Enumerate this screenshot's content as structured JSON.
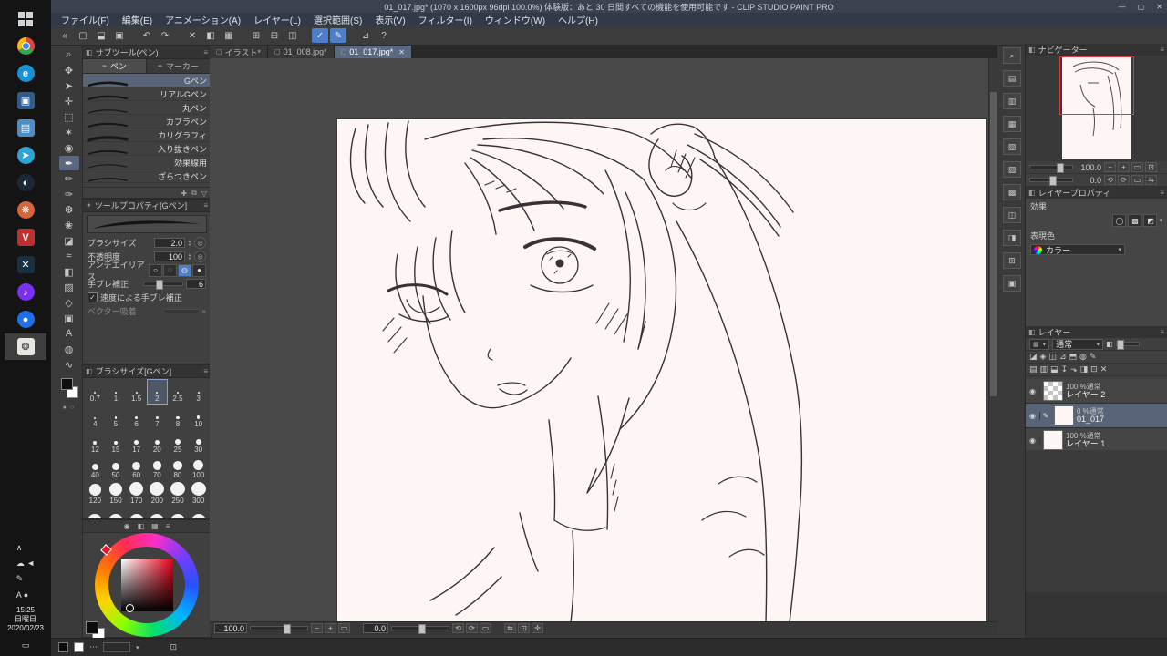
{
  "colors": {
    "accent": "#4f7dc8",
    "selection": "#5a6478",
    "paper": "#fdf6f4",
    "nav_frame": "#e03a3a",
    "line_art": "#3a3136",
    "taskbar_selected": "#3f3f3f"
  },
  "ui": {
    "header_tab_glyph": "◧",
    "panel_menu_glyph": "≡",
    "pen_tab_glyph": "✒",
    "close_glyph": "✕",
    "doc_glyph": "▢"
  },
  "taskbar": {
    "icons": [
      {
        "name": "start",
        "shape": "win",
        "glyph": ""
      },
      {
        "name": "chrome",
        "shape": "chrome",
        "glyph": ""
      },
      {
        "name": "edge",
        "shape": "circle",
        "glyph": "e",
        "bg": "#1493d6"
      },
      {
        "name": "pinned-app-1",
        "shape": "square",
        "glyph": "▣",
        "bg": "#2d5e8f"
      },
      {
        "name": "pinned-app-2",
        "shape": "square",
        "glyph": "▤",
        "bg": "#4d8fc4"
      },
      {
        "name": "telegram",
        "shape": "circle",
        "glyph": "➤",
        "bg": "#2ea3d6"
      },
      {
        "name": "steam",
        "shape": "circle",
        "glyph": "◐",
        "bg": "#1b2838"
      },
      {
        "name": "pinned-app-3",
        "shape": "circle",
        "glyph": "❋",
        "bg": "#d9643a"
      },
      {
        "name": "voice-app",
        "shape": "square",
        "glyph": "V",
        "bg": "#c02e2e"
      },
      {
        "name": "pinned-app-4",
        "shape": "square",
        "glyph": "✕",
        "bg": "#173042"
      },
      {
        "name": "music-app",
        "shape": "circle",
        "glyph": "♪",
        "bg": "#7b2ff7"
      },
      {
        "name": "pinned-app-5",
        "shape": "circle",
        "glyph": "●",
        "bg": "#1f6feb"
      },
      {
        "name": "clip-studio-paint",
        "shape": "square",
        "glyph": "❂",
        "bg": "#e9e5df",
        "fg": "#3a3a3a",
        "selected": true
      }
    ],
    "tray": [
      {
        "name": "tray-chevron-icon",
        "glyph": "∧"
      },
      {
        "name": "tray-cloud-volume-icons",
        "glyph": "☁ ◄"
      },
      {
        "name": "tray-pen-icon",
        "glyph": "✎"
      },
      {
        "name": "tray-ime-icons",
        "glyph": "A ●"
      }
    ],
    "clock": {
      "time": "15:25",
      "weekday": "日曜日",
      "date": "2020/02/23"
    },
    "show_desktop_glyph": "▭"
  },
  "window": {
    "title": "01_017.jpg* (1070 x 1600px 96dpi 100.0%) 体験版：あと 30 日間すべての機能を使用可能です - CLIP STUDIO PAINT PRO",
    "controls": {
      "minimize": "—",
      "maximize": "▢",
      "close": "✕"
    },
    "menus": [
      {
        "name": "file",
        "label": "ファイル(F)"
      },
      {
        "name": "edit",
        "label": "編集(E)"
      },
      {
        "name": "animation",
        "label": "アニメーション(A)"
      },
      {
        "name": "layer",
        "label": "レイヤー(L)"
      },
      {
        "name": "selection",
        "label": "選択範囲(S)"
      },
      {
        "name": "view",
        "label": "表示(V)"
      },
      {
        "name": "filter",
        "label": "フィルター(I)"
      },
      {
        "name": "window",
        "label": "ウィンドウ(W)"
      },
      {
        "name": "help",
        "label": "ヘルプ(H)"
      }
    ],
    "toolbar": [
      {
        "name": "collapse-left",
        "glyph": "«"
      },
      {
        "name": "new-canvas",
        "glyph": "▢"
      },
      {
        "name": "open-file",
        "glyph": "⬓"
      },
      {
        "name": "save-file",
        "glyph": "▣"
      },
      {
        "sep": true
      },
      {
        "name": "undo",
        "glyph": "↶"
      },
      {
        "name": "redo",
        "glyph": "↷"
      },
      {
        "sep": true
      },
      {
        "name": "delete",
        "glyph": "✕"
      },
      {
        "name": "fill",
        "glyph": "◧"
      },
      {
        "name": "grid",
        "glyph": "▦"
      },
      {
        "sep": true
      },
      {
        "name": "snap-to-ruler",
        "glyph": "⊞"
      },
      {
        "name": "snap-to-special-ruler",
        "glyph": "⊟"
      },
      {
        "name": "snap-to-grid",
        "glyph": "◫"
      },
      {
        "sep": true
      },
      {
        "name": "select-vector",
        "glyph": "✓",
        "active": true
      },
      {
        "name": "edit-vector",
        "glyph": "✎",
        "active": true
      },
      {
        "sep": true
      },
      {
        "name": "ruler",
        "glyph": "⊿"
      },
      {
        "name": "help",
        "glyph": "?"
      }
    ],
    "toolstrip": {
      "selected": 7,
      "tools": [
        {
          "name": "zoom-tool",
          "glyph": "⌕"
        },
        {
          "name": "move-tool",
          "glyph": "✥"
        },
        {
          "name": "operation-tool",
          "glyph": "➤"
        },
        {
          "name": "layer-move-tool",
          "glyph": "✛"
        },
        {
          "name": "marquee-tool",
          "glyph": "⬚"
        },
        {
          "name": "auto-select-tool",
          "glyph": "✶"
        },
        {
          "name": "eyedropper-tool",
          "glyph": "◉"
        },
        {
          "name": "pen-tool",
          "glyph": "✒"
        },
        {
          "name": "pencil-tool",
          "glyph": "✏"
        },
        {
          "name": "brush-tool",
          "glyph": "✑"
        },
        {
          "name": "airbrush-tool",
          "glyph": "❆"
        },
        {
          "name": "decoration-tool",
          "glyph": "❀"
        },
        {
          "name": "eraser-tool",
          "glyph": "◪"
        },
        {
          "name": "blend-tool",
          "glyph": "≈"
        },
        {
          "name": "fill-tool",
          "glyph": "◧"
        },
        {
          "name": "gradient-tool",
          "glyph": "▨"
        },
        {
          "name": "figure-tool",
          "glyph": "◇"
        },
        {
          "name": "frame-border-tool",
          "glyph": "▣"
        },
        {
          "name": "text-tool",
          "glyph": "A"
        },
        {
          "name": "balloon-tool",
          "glyph": "◍"
        },
        {
          "name": "correct-line-tool",
          "glyph": "∿"
        }
      ]
    }
  },
  "subtool_panel": {
    "title": "サブツール(ペン)",
    "tabs": [
      {
        "label": "ペン",
        "active": true
      },
      {
        "label": "マーカー",
        "active": false
      }
    ],
    "items": [
      "Gペン",
      "リアルGペン",
      "丸ペン",
      "カブラペン",
      "カリグラフィ",
      "入り抜きペン",
      "効果線用",
      "ざらつきペン"
    ],
    "selected": "Gペン",
    "stroke_widths": [
      2.6,
      2.2,
      1.2,
      2.0,
      3.2,
      1.8,
      1.1,
      1.6
    ],
    "footer_icons": [
      {
        "name": "add-subtool-icon",
        "glyph": "✚"
      },
      {
        "name": "duplicate-subtool-icon",
        "glyph": "⧉"
      },
      {
        "name": "delete-subtool-icon",
        "glyph": "▽"
      }
    ]
  },
  "tool_property": {
    "title": "ツールプロパティ[Gペン]",
    "brush_size_label": "ブラシサイズ",
    "brush_size_value": "2.0",
    "opacity_label": "不透明度",
    "opacity_value": "100",
    "antialias_label": "アンチエイリアス",
    "antialias_selected": 2,
    "antialias_glyphs": [
      "○",
      "◌",
      "◍",
      "●"
    ],
    "stabilize_label": "手ブレ補正",
    "stabilize_value": "6",
    "speed_stabilize_label": "速度による手ブレ補正",
    "vector_snap_label": "ベクター吸着"
  },
  "brush_size_panel": {
    "title": "ブラシサイズ[Gペン]",
    "sizes": [
      "0.7",
      "1",
      "1.5",
      "2",
      "2.5",
      "3",
      "4",
      "5",
      "6",
      "7",
      "8",
      "10",
      "12",
      "15",
      "17",
      "20",
      "25",
      "30",
      "40",
      "50",
      "60",
      "70",
      "80",
      "100",
      "120",
      "150",
      "170",
      "200",
      "250",
      "300"
    ],
    "selected": "2",
    "overflow_dots": 6
  },
  "color_panel": {
    "header_icons": [
      {
        "name": "color-wheel-tab-icon",
        "glyph": "◉"
      },
      {
        "name": "color-slider-tab-icon",
        "glyph": "◧"
      },
      {
        "name": "color-set-tab-icon",
        "glyph": "▦"
      },
      {
        "name": "color-history-tab-icon",
        "glyph": "≡"
      }
    ]
  },
  "canvas": {
    "tabs": [
      {
        "label": "イラスト*",
        "active": false
      },
      {
        "label": "01_008.jpg*",
        "active": false
      },
      {
        "label": "01_017.jpg*",
        "active": true
      }
    ],
    "status": {
      "zoom": "100.0",
      "rotation": "0.0"
    },
    "zoom_icons": [
      {
        "name": "zoom-out-icon",
        "glyph": "−"
      },
      {
        "name": "zoom-in-icon",
        "glyph": "+"
      },
      {
        "name": "fit-to-screen-icon",
        "glyph": "▭"
      }
    ],
    "rotate_icons": [
      {
        "name": "rotate-left-icon",
        "glyph": "⟲"
      },
      {
        "name": "rotate-right-icon",
        "glyph": "⟳"
      },
      {
        "name": "reset-rotation-icon",
        "glyph": "▭"
      }
    ],
    "extra_icons": [
      {
        "name": "flip-horizontal-icon",
        "glyph": "⇋"
      },
      {
        "name": "reset-view-icon",
        "glyph": "⊡"
      },
      {
        "name": "move-view-icon",
        "glyph": "✛"
      }
    ]
  },
  "side_buttons": [
    {
      "name": "side-zoom-button",
      "glyph": "⌕"
    },
    {
      "name": "side-launcher-1",
      "glyph": "▤"
    },
    {
      "name": "side-launcher-2",
      "glyph": "▥"
    },
    {
      "name": "side-launcher-3",
      "glyph": "▦"
    },
    {
      "name": "side-launcher-4",
      "glyph": "▧"
    },
    {
      "name": "side-launcher-5",
      "glyph": "▨"
    },
    {
      "name": "side-launcher-6",
      "glyph": "▩"
    },
    {
      "name": "side-launcher-7",
      "glyph": "◫"
    },
    {
      "name": "side-launcher-8",
      "glyph": "◨"
    },
    {
      "name": "side-launcher-9",
      "glyph": "⊞"
    },
    {
      "name": "side-launcher-10",
      "glyph": "▣"
    }
  ],
  "navigator": {
    "title": "ナビゲーター",
    "zoom": "100.0",
    "rotation": "0.0",
    "zoom_icons": [
      {
        "name": "nav-zoom-out-icon",
        "glyph": "−"
      },
      {
        "name": "nav-zoom-in-icon",
        "glyph": "+"
      },
      {
        "name": "nav-fit-icon",
        "glyph": "▭"
      },
      {
        "name": "nav-actual-size-icon",
        "glyph": "⊡"
      }
    ],
    "rotate_icons": [
      {
        "name": "nav-rotate-left-icon",
        "glyph": "⟲"
      },
      {
        "name": "nav-rotate-right-icon",
        "glyph": "⟳"
      },
      {
        "name": "nav-reset-icon",
        "glyph": "▭"
      },
      {
        "name": "nav-flip-icon",
        "glyph": "⇋"
      }
    ]
  },
  "layer_property": {
    "title": "レイヤープロパティ",
    "effect_label": "効果",
    "effect_icons": [
      {
        "name": "border-effect-icon",
        "glyph": "◯"
      },
      {
        "name": "tone-effect-icon",
        "glyph": "▩"
      },
      {
        "name": "layer-color-effect-icon",
        "glyph": "◩"
      }
    ],
    "color_mode_label": "表現色",
    "color_mode_value": "カラー"
  },
  "layer_panel": {
    "title": "レイヤー",
    "blend_mode": "通常",
    "row2_icons": [
      {
        "name": "lock-transparent-icon",
        "glyph": "◪"
      },
      {
        "name": "lock-layer-icon",
        "glyph": "◈"
      },
      {
        "name": "enable-mask-icon",
        "glyph": "◫"
      },
      {
        "name": "set-ruler-icon",
        "glyph": "⊿"
      },
      {
        "name": "clip-below-icon",
        "glyph": "⬒"
      },
      {
        "name": "reference-layer-icon",
        "glyph": "◍"
      },
      {
        "name": "draft-layer-icon",
        "glyph": "✎"
      }
    ],
    "row3_icons": [
      {
        "name": "new-raster-layer-icon",
        "glyph": "▤"
      },
      {
        "name": "new-vector-layer-icon",
        "glyph": "▥"
      },
      {
        "name": "new-folder-icon",
        "glyph": "⬓"
      },
      {
        "name": "transfer-down-icon",
        "glyph": "↧"
      },
      {
        "name": "merge-down-icon",
        "glyph": "⬎"
      },
      {
        "name": "create-mask-icon",
        "glyph": "◨"
      },
      {
        "name": "apply-mask-icon",
        "glyph": "⊡"
      },
      {
        "name": "delete-layer-icon",
        "glyph": "✕"
      }
    ],
    "layers": [
      {
        "opacity_text": "100 %通常",
        "name": "レイヤー 2",
        "thumb": "checker",
        "selected": false
      },
      {
        "opacity_text": "0 %通常",
        "name": "01_017",
        "thumb": "paper",
        "selected": true
      },
      {
        "opacity_text": "100 %通常",
        "name": "レイヤー 1",
        "thumb": "paper",
        "selected": false
      }
    ]
  }
}
